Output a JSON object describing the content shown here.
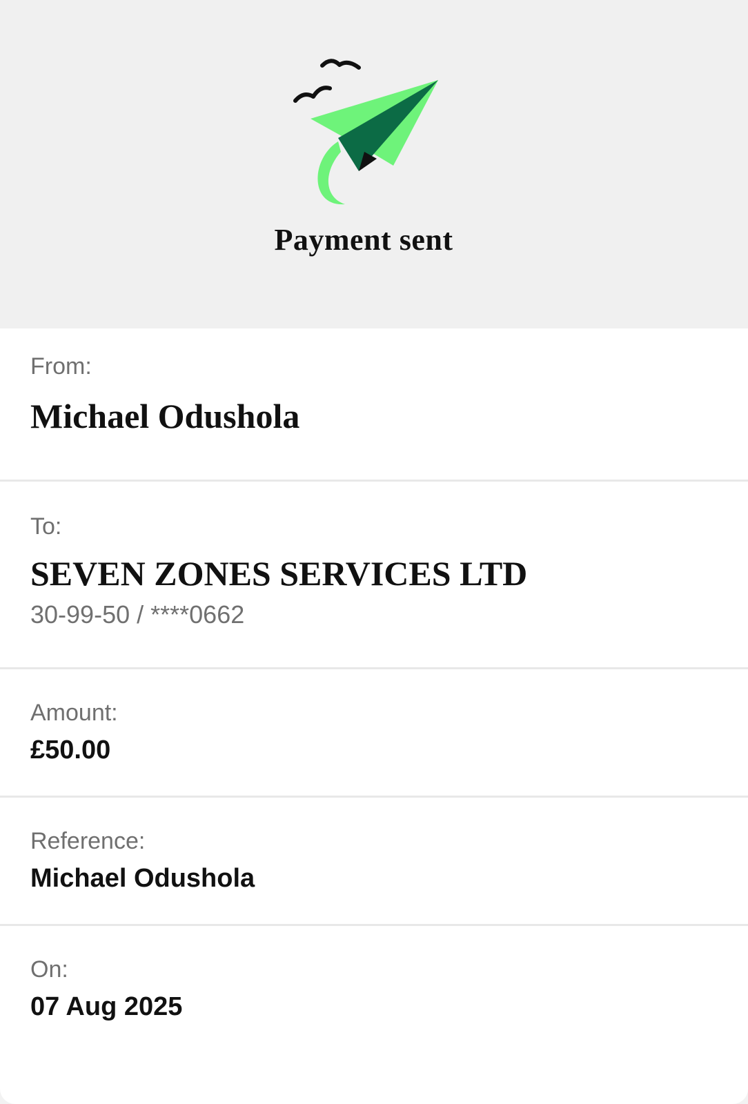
{
  "header": {
    "title": "Payment sent",
    "illustration_icon": "paper-plane-with-birds-icon",
    "colors": {
      "plane_light": "#6ef37a",
      "plane_dark": "#0c6b45",
      "birds": "#111111",
      "background": "#f0f0f0"
    }
  },
  "details": {
    "from": {
      "label": "From:",
      "value": "Michael Odushola"
    },
    "to": {
      "label": "To:",
      "value": "SEVEN ZONES SERVICES LTD",
      "account": "30-99-50 / ****0662"
    },
    "amount": {
      "label": "Amount:",
      "value": "£50.00"
    },
    "reference": {
      "label": "Reference:",
      "value": "Michael Odushola"
    },
    "on": {
      "label": "On:",
      "value": "07 Aug 2025"
    }
  }
}
